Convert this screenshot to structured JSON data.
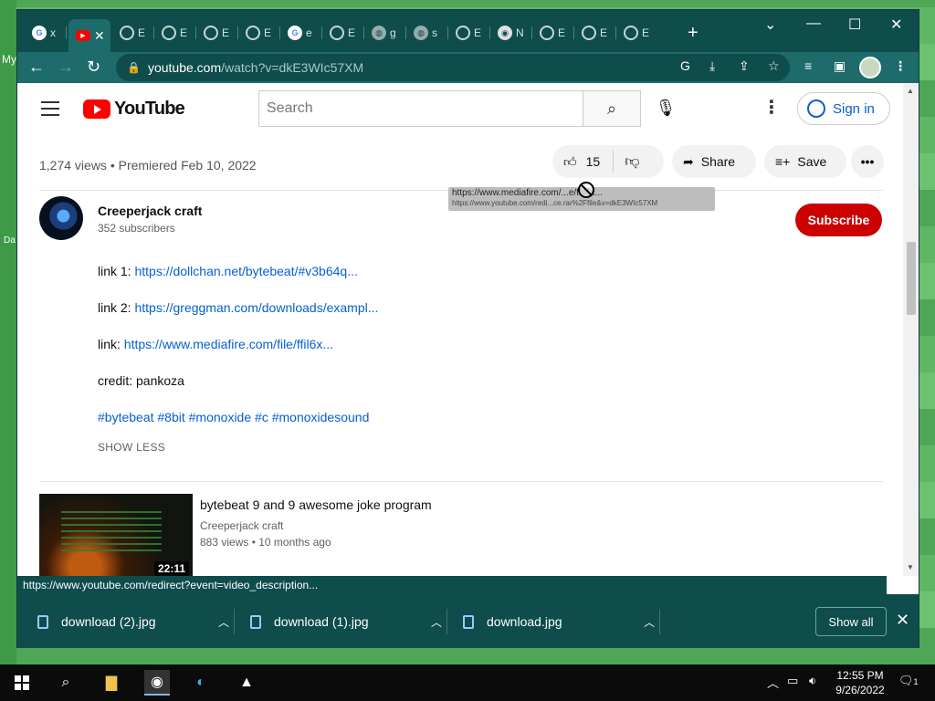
{
  "desktop": {
    "labels": [
      "My",
      "Da"
    ]
  },
  "browser": {
    "tabs": [
      {
        "icon": "google-icon",
        "text": "x"
      },
      {
        "icon": "youtube-icon",
        "text": "",
        "active": true
      },
      {
        "icon": "github-icon",
        "text": "E"
      },
      {
        "icon": "github-icon",
        "text": "E"
      },
      {
        "icon": "github-icon",
        "text": "E"
      },
      {
        "icon": "github-icon",
        "text": "E"
      },
      {
        "icon": "google-icon",
        "text": "e"
      },
      {
        "icon": "github-icon",
        "text": "E"
      },
      {
        "icon": "globe-icon",
        "text": "g"
      },
      {
        "icon": "globe-icon",
        "text": "s"
      },
      {
        "icon": "github-icon",
        "text": "E"
      },
      {
        "icon": "chrome-icon",
        "text": "N"
      },
      {
        "icon": "github-icon",
        "text": "E"
      },
      {
        "icon": "github-icon",
        "text": "E"
      },
      {
        "icon": "github-icon",
        "text": "E"
      }
    ],
    "url_domain": "youtube.com",
    "url_path": "/watch?v=dkE3WIc57XM"
  },
  "youtube": {
    "logo_text": "YouTube",
    "search_placeholder": "Search",
    "signin_label": "Sign in",
    "views_line": "1,274 views • Premiered Feb 10, 2022",
    "likes": "15",
    "share_label": "Share",
    "save_label": "Save",
    "tooltip_line1": "https://www.mediafire.com/...e/ffil6x...",
    "tooltip_line2": "https://www.youtube.com/redi...ce.rar%2Ffile&v=dkE3WIc57XM",
    "channel": {
      "name": "Creeperjack craft",
      "subscribers": "352 subscribers",
      "subscribe_label": "Subscribe"
    },
    "description": {
      "link1_prefix": "link 1: ",
      "link1": "https://dollchan.net/bytebeat/#v3b64q...",
      "link2_prefix": "link 2: ",
      "link2": "https://greggman.com/downloads/exampl...",
      "link3_prefix": "link: ",
      "link3": "https://www.mediafire.com/file/ffil6x...",
      "credit": "credit: pankoza",
      "hashtags": [
        "#bytebeat",
        "#8bit",
        "#monoxide",
        "#c",
        "#monoxidesound"
      ],
      "show_less": "SHOW LESS"
    },
    "recommended": {
      "title": "bytebeat 9 and 9 awesome joke program",
      "channel": "Creeperjack craft",
      "meta": "883 views • 10 months ago",
      "duration": "22:11"
    }
  },
  "statusbar": "https://www.youtube.com/redirect?event=video_description...",
  "downloads": {
    "items": [
      "download (2).jpg",
      "download (1).jpg",
      "download.jpg"
    ],
    "show_all": "Show all"
  },
  "taskbar": {
    "time": "12:55 PM",
    "date": "9/26/2022",
    "notification_count": "1"
  },
  "colors": {
    "accent": "#0f4c4c",
    "subscribe": "#cc0000",
    "link": "#065fd4"
  }
}
